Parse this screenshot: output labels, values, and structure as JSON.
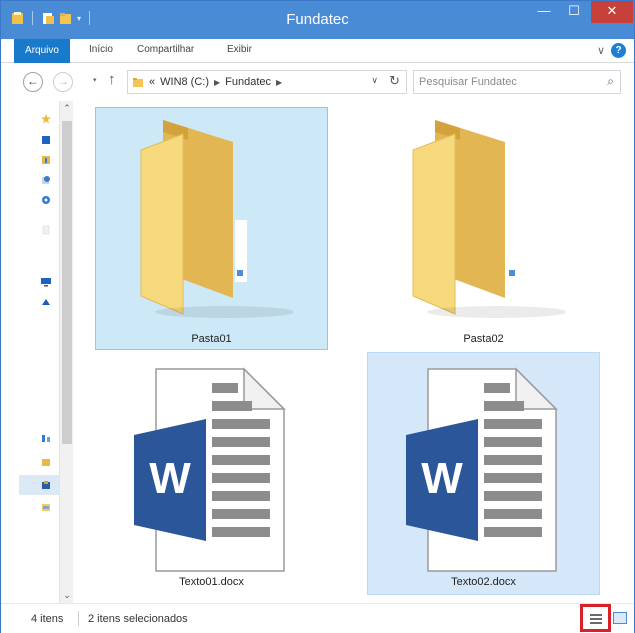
{
  "window": {
    "title": "Fundatec",
    "controls": {
      "minimize": "—",
      "maximize": "☐",
      "close": "✕"
    }
  },
  "quick_access": {
    "icons": [
      "properties-icon",
      "new-folder-icon",
      "folder-icon"
    ],
    "dropdown": "▾"
  },
  "ribbon": {
    "tabs": [
      {
        "label": "Arquivo",
        "active": true
      },
      {
        "label": "Início"
      },
      {
        "label": "Compartilhar"
      },
      {
        "label": "Exibir"
      }
    ],
    "expand": "∨",
    "help": "?"
  },
  "address_bar": {
    "back": "←",
    "forward": "→",
    "recent": "▾",
    "up": "↑",
    "overflow": "«",
    "breadcrumb": [
      "WIN8 (C:)",
      "Fundatec"
    ],
    "separator": "▶",
    "dropdown": "∨",
    "refresh": "↻"
  },
  "search": {
    "placeholder": "Pesquisar Fundatec",
    "icon": "⌕"
  },
  "nav_pane": {
    "icons": [
      "favorites-star-icon",
      "desktop-icon",
      "downloads-icon",
      "recent-places-icon",
      "homegroup-icon",
      "blank-icon",
      "this-pc-icon",
      "onedrive-icon",
      "network-icon",
      "library-icon",
      "pictures-icon",
      "documents-icon"
    ],
    "scroll_up": "⌃",
    "scroll_down": "⌄"
  },
  "items": [
    {
      "name": "Pasta01",
      "type": "folder",
      "selected": true
    },
    {
      "name": "Pasta02",
      "type": "folder",
      "selected": false
    },
    {
      "name": "Texto01.docx",
      "type": "word-document",
      "selected": false
    },
    {
      "name": "Texto02.docx",
      "type": "word-document",
      "selected": true
    }
  ],
  "word_letter": "W",
  "status_bar": {
    "item_count": "4 itens",
    "selection": "2 itens selecionados",
    "views": [
      "details-view",
      "large-icons-view"
    ]
  },
  "colors": {
    "titlebar": "#4a8bd6",
    "file_tab": "#1979ca",
    "close": "#c7413a",
    "selection_1": "#cde8f7",
    "selection_2": "#d5e8fa",
    "word_blue": "#2b579a",
    "highlight_box": "#d8202a"
  }
}
